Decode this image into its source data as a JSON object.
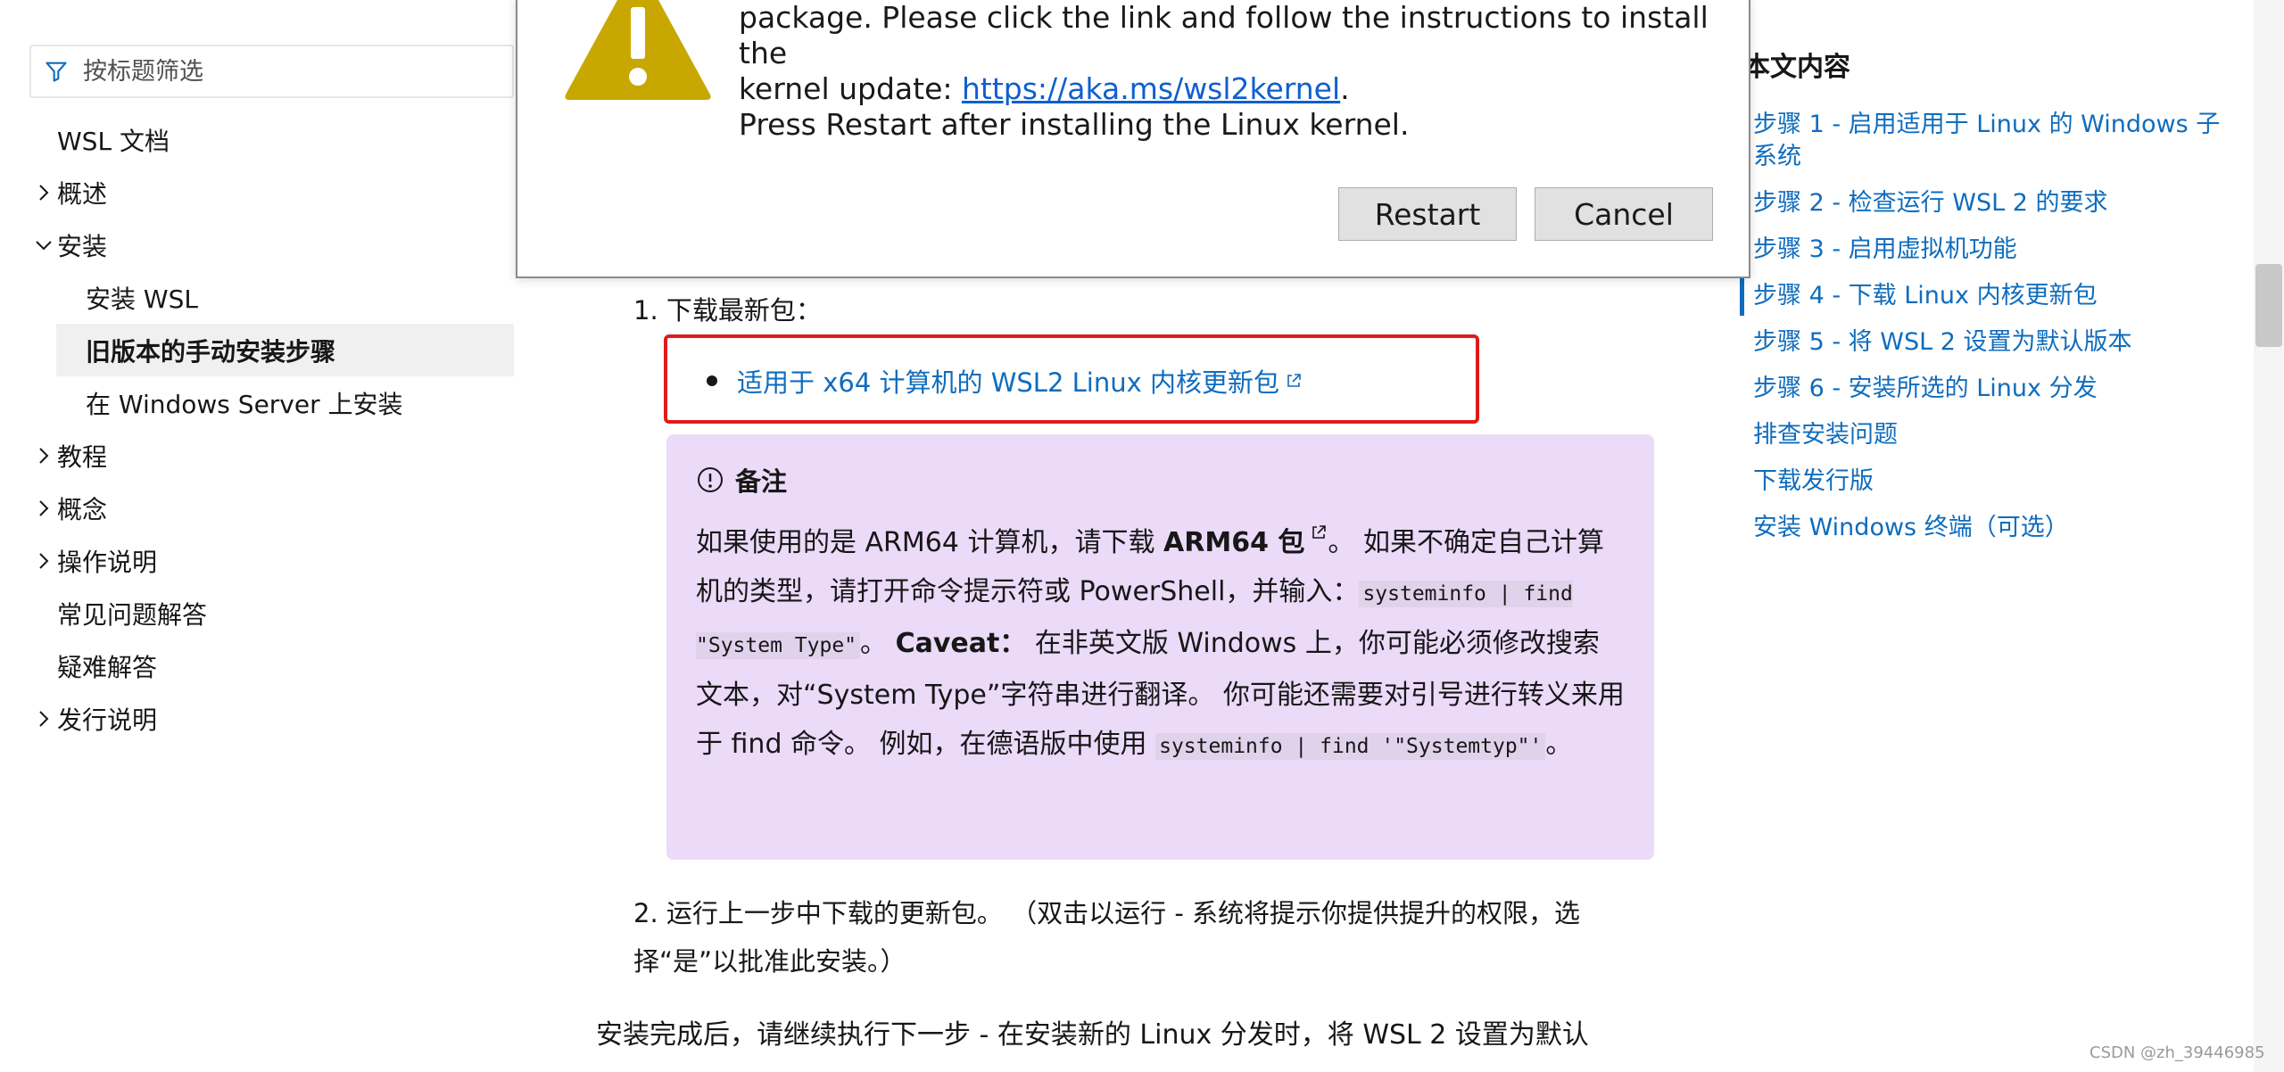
{
  "filter": {
    "placeholder": "按标题筛选",
    "icon": "filter-icon"
  },
  "nav": {
    "items": [
      {
        "label": "WSL 文档"
      },
      {
        "label": "概述"
      },
      {
        "label": "安装"
      },
      {
        "label": "安装 WSL"
      },
      {
        "label": "旧版本的手动安装步骤"
      },
      {
        "label": "在 Windows Server 上安装"
      },
      {
        "label": "教程"
      },
      {
        "label": "概念"
      },
      {
        "label": "操作说明"
      },
      {
        "label": "常见问题解答"
      },
      {
        "label": "疑难解答"
      },
      {
        "label": "发行说明"
      }
    ]
  },
  "dialog": {
    "line1": "package. Please click the link and follow the instructions to install the",
    "line2_prefix": "kernel update: ",
    "link": "https://aka.ms/wsl2kernel",
    "line2_suffix": ".",
    "line3": "Press Restart after installing the Linux kernel.",
    "restart_label": "Restart",
    "cancel_label": "Cancel",
    "icon": "warning-icon"
  },
  "main": {
    "step1": "1. 下载最新包：",
    "download_link": "适用于 x64 计算机的 WSL2 Linux 内核更新包",
    "note": {
      "title": "备注",
      "p1": "如果使用的是 ARM64 计算机，请下载 ",
      "arm_link": "ARM64 包",
      "p2": "。 如果不确定自己计算机的类型，请打开命令提示符或 PowerShell，并输入：",
      "code1": "systeminfo | find \"System Type\"",
      "p3": "。 ",
      "caveat": "Caveat：",
      "p4": " 在非英文版 Windows 上，你可能必须修改搜索文本，对“System Type”字符串进行翻译。 你可能还需要对引号进行转义来用于 find 命令。 例如，在德语版中使用 ",
      "code2": "systeminfo | find '\"Systemtyp\"'",
      "p5": "。"
    },
    "step2": "2. 运行上一步中下载的更新包。 （双击以运行 - 系统将提示你提供提升的权限，选择“是”以批准此安装。）",
    "para": "安装完成后，请继续执行下一步 - 在安装新的 Linux 分发时，将 WSL 2 设置为默认"
  },
  "toc": {
    "title": "本文内容",
    "items": [
      "步骤 1 - 启用适用于 Linux 的 Windows 子系统",
      "步骤 2 - 检查运行 WSL 2 的要求",
      "步骤 3 - 启用虚拟机功能",
      "步骤 4 - 下载 Linux 内核更新包",
      "步骤 5 - 将 WSL 2 设置为默认版本",
      "步骤 6 - 安装所选的 Linux 分发",
      "排查安装问题",
      "下载发行版",
      "安装 Windows 终端（可选）"
    ]
  },
  "watermark": "CSDN @zh_39446985",
  "colors": {
    "link": "#0f6cbd",
    "note_bg": "#ebdaf8",
    "highlight": "#e01b1b",
    "warning": "#c8a800"
  }
}
